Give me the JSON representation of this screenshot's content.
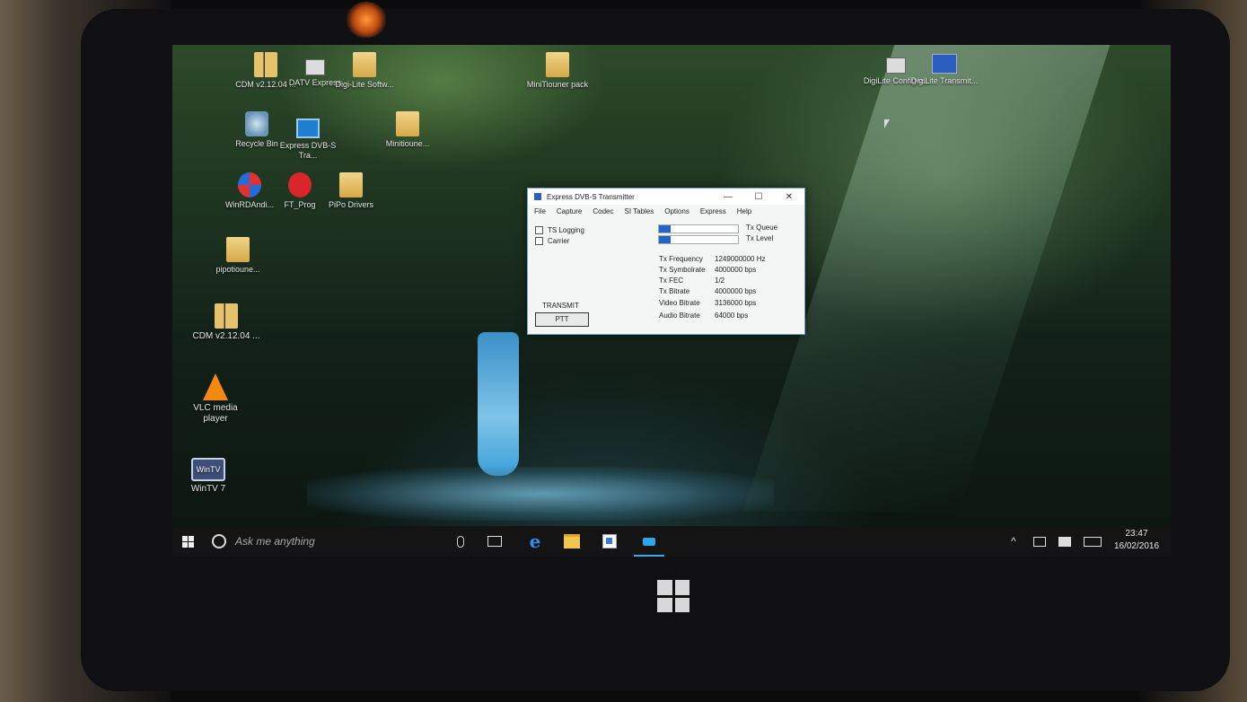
{
  "desktop": {
    "icons": [
      {
        "label": "CDM v2.12.04 ...",
        "icon": "zip-folder-icon"
      },
      {
        "label": "DATV Express",
        "icon": "shortcut-icon"
      },
      {
        "label": "Digi-Lite Softw...",
        "icon": "folder-icon"
      },
      {
        "label": "MiniTiouner pack",
        "icon": "folder-icon"
      },
      {
        "label": "DigiLite Config v...",
        "icon": "window-icon"
      },
      {
        "label": "DigiLite Transmit...",
        "icon": "window-icon"
      },
      {
        "label": "Recycle Bin",
        "icon": "recycle-bin-icon"
      },
      {
        "label": "Express DVB-S Tra...",
        "icon": "monitor-icon"
      },
      {
        "label": "Minitioune...",
        "icon": "folder-icon"
      },
      {
        "label": "WinRDAndi...",
        "icon": "app-icon"
      },
      {
        "label": "FT_Prog",
        "icon": "app-icon"
      },
      {
        "label": "PiPo Drivers",
        "icon": "folder-icon"
      },
      {
        "label": "pipotioune...",
        "icon": "folder-icon"
      },
      {
        "label": "CDM v2.12.04 ...",
        "icon": "zip-folder-icon"
      },
      {
        "label": "VLC media player",
        "icon": "vlc-icon"
      },
      {
        "label": "WinTV 7",
        "icon": "wintv-icon"
      }
    ]
  },
  "app_window": {
    "title": "Express DVB-S Transmitter",
    "minimize": "—",
    "maximize": "☐",
    "close": "✕",
    "menu": [
      "File",
      "Capture",
      "Codec",
      "SI Tables",
      "Options",
      "Express",
      "Help"
    ],
    "checkboxes": {
      "ts_logging": {
        "label": "TS Logging",
        "checked": false
      },
      "carrier": {
        "label": "Carrier",
        "checked": false
      }
    },
    "bars": {
      "tx_queue": {
        "label": "Tx Queue",
        "fill": 0.15
      },
      "tx_level": {
        "label": "Tx Level",
        "fill": 0.15
      }
    },
    "stats": [
      {
        "key": "Tx Frequency",
        "value": "1249000000 Hz"
      },
      {
        "key": "Tx Symbolrate",
        "value": "4000000 bps"
      },
      {
        "key": "Tx FEC",
        "value": "1/2"
      },
      {
        "key": "Tx Bitrate",
        "value": "4000000 bps"
      },
      {
        "key": "Video Bitrate",
        "value": "3136000 bps"
      },
      {
        "key": "Audio Bitrate",
        "value": "64000 bps"
      }
    ],
    "transmit_label": "TRANSMIT",
    "ptt_button": "PTT"
  },
  "taskbar": {
    "search_placeholder": "Ask me anything",
    "clock_time": "23:47",
    "clock_date": "16/02/2016"
  }
}
